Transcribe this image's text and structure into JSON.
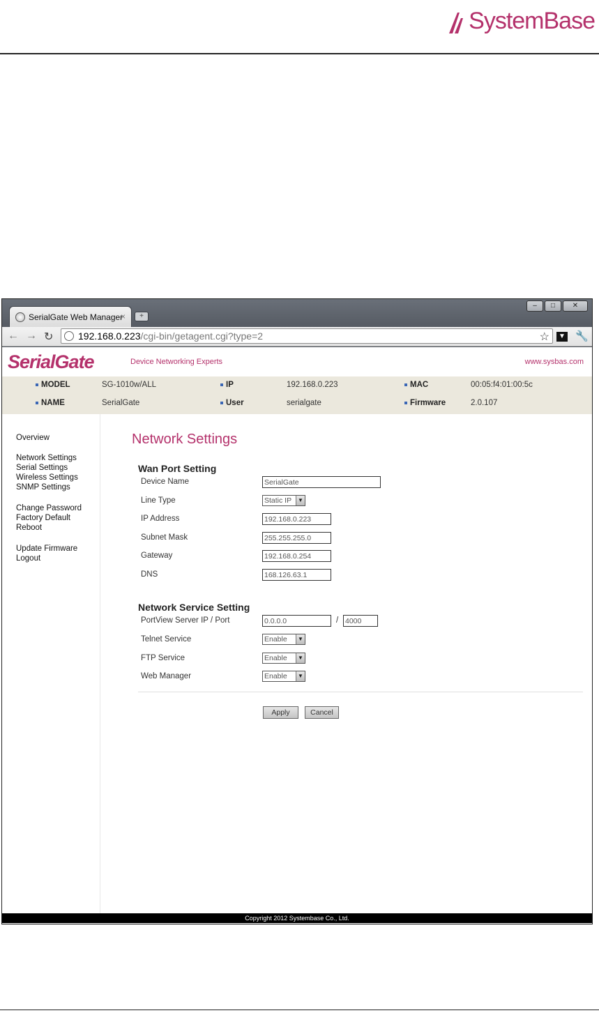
{
  "doc": {
    "logo_text": "SystemBase"
  },
  "browser": {
    "tab_title": "SerialGate Web Manager",
    "tab_close": "×",
    "url_host": "192.168.0.223",
    "url_path": "/cgi-bin/getagent.cgi?type=2"
  },
  "header": {
    "brand": "SerialGate",
    "tagline": "Device Networking Experts",
    "site": "www.sysbas.com"
  },
  "info": {
    "model_label": "MODEL",
    "model_value": "SG-1010w/ALL",
    "ip_label": "IP",
    "ip_value": "192.168.0.223",
    "mac_label": "MAC",
    "mac_value": "00:05:f4:01:00:5c",
    "name_label": "NAME",
    "name_value": "SerialGate",
    "user_label": "User",
    "user_value": "serialgate",
    "firmware_label": "Firmware",
    "firmware_value": "2.0.107"
  },
  "sidebar": {
    "items": [
      "Overview",
      "Network Settings",
      "Serial Settings",
      "Wireless Settings",
      "SNMP Settings",
      "Change Password",
      "Factory Default",
      "Reboot",
      "Update Firmware",
      "Logout"
    ]
  },
  "main": {
    "title": "Network Settings",
    "wan": {
      "heading": "Wan Port Setting",
      "device_name_label": "Device Name",
      "device_name_value": "SerialGate",
      "line_type_label": "Line Type",
      "line_type_value": "Static IP",
      "ip_label": "IP Address",
      "ip_value": "192.168.0.223",
      "subnet_label": "Subnet Mask",
      "subnet_value": "255.255.255.0",
      "gateway_label": "Gateway",
      "gateway_value": "192.168.0.254",
      "dns_label": "DNS",
      "dns_value": "168.126.63.1"
    },
    "service": {
      "heading": "Network Service Setting",
      "portview_label": "PortView Server IP / Port",
      "portview_ip": "0.0.0.0",
      "portview_sep": "/",
      "portview_port": "4000",
      "telnet_label": "Telnet Service",
      "telnet_value": "Enable",
      "ftp_label": "FTP Service",
      "ftp_value": "Enable",
      "web_label": "Web Manager",
      "web_value": "Enable"
    },
    "apply_label": "Apply",
    "cancel_label": "Cancel"
  },
  "footer": {
    "copyright": "Copyright 2012 Systembase Co., Ltd."
  },
  "colors": {
    "brand": "#b4316b",
    "info_bg": "#ebe8dd",
    "bullet": "#3a66b5"
  }
}
